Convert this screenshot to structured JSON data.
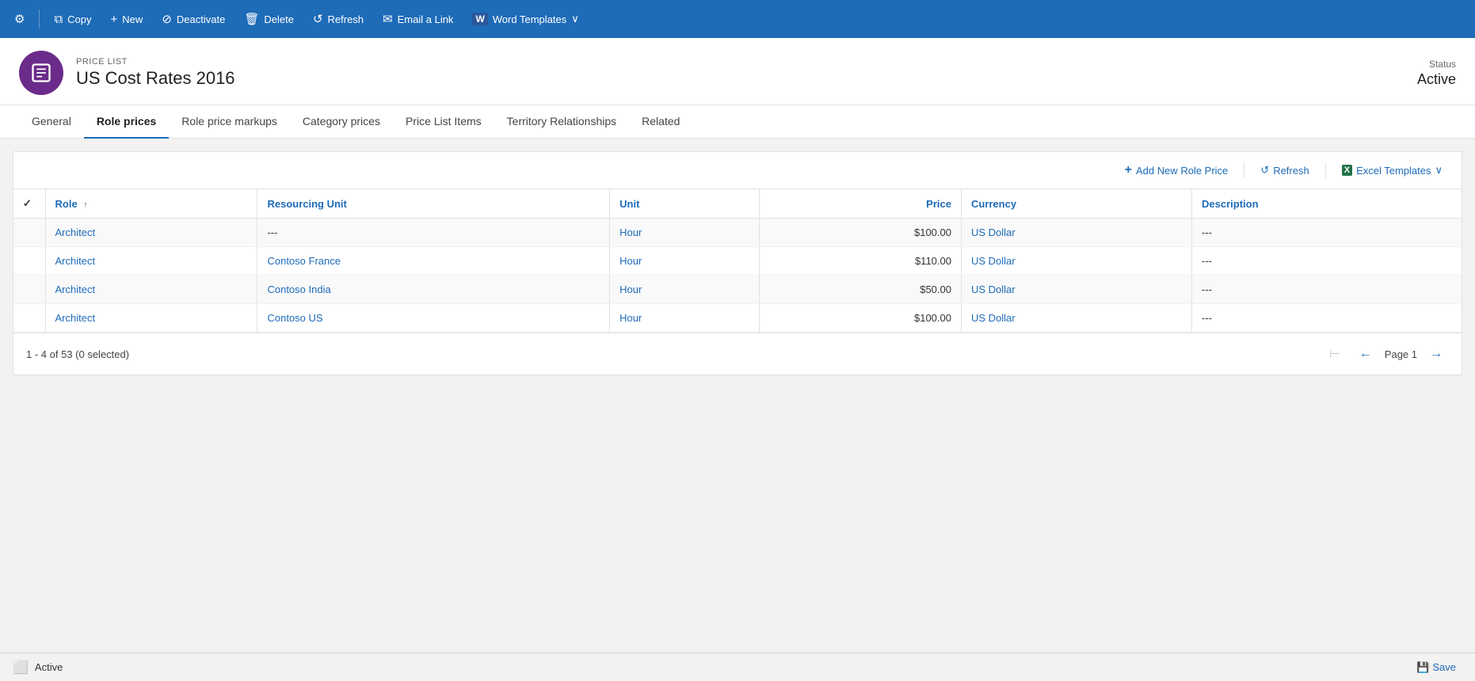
{
  "toolbar": {
    "buttons": [
      {
        "id": "settings",
        "label": "",
        "icon": "⚙"
      },
      {
        "id": "copy",
        "label": "Copy",
        "icon": "⧉"
      },
      {
        "id": "new",
        "label": "New",
        "icon": "+"
      },
      {
        "id": "deactivate",
        "label": "Deactivate",
        "icon": "⊘"
      },
      {
        "id": "delete",
        "label": "Delete",
        "icon": "🗑"
      },
      {
        "id": "refresh",
        "label": "Refresh",
        "icon": "↺"
      },
      {
        "id": "email",
        "label": "Email a Link",
        "icon": "✉"
      },
      {
        "id": "word",
        "label": "Word Templates",
        "icon": "W",
        "hasDropdown": true
      }
    ]
  },
  "record": {
    "type": "PRICE LIST",
    "name": "US Cost Rates 2016",
    "status_label": "Status",
    "status_value": "Active"
  },
  "tabs": [
    {
      "id": "general",
      "label": "General",
      "active": false
    },
    {
      "id": "role-prices",
      "label": "Role prices",
      "active": true
    },
    {
      "id": "role-price-markups",
      "label": "Role price markups",
      "active": false
    },
    {
      "id": "category-prices",
      "label": "Category prices",
      "active": false
    },
    {
      "id": "price-list-items",
      "label": "Price List Items",
      "active": false
    },
    {
      "id": "territory-relationships",
      "label": "Territory Relationships",
      "active": false
    },
    {
      "id": "related",
      "label": "Related",
      "active": false
    }
  ],
  "grid": {
    "add_button_label": "Add New Role Price",
    "refresh_button_label": "Refresh",
    "excel_button_label": "Excel Templates",
    "columns": [
      {
        "id": "check",
        "label": "",
        "type": "check"
      },
      {
        "id": "role",
        "label": "Role",
        "sortable": true
      },
      {
        "id": "resourcing_unit",
        "label": "Resourcing Unit"
      },
      {
        "id": "unit",
        "label": "Unit"
      },
      {
        "id": "price",
        "label": "Price",
        "align": "right"
      },
      {
        "id": "currency",
        "label": "Currency"
      },
      {
        "id": "description",
        "label": "Description"
      }
    ],
    "rows": [
      {
        "role": "Architect",
        "resourcing_unit": "---",
        "unit": "Hour",
        "price": "$100.00",
        "currency": "US Dollar",
        "description": "---"
      },
      {
        "role": "Architect",
        "resourcing_unit": "Contoso France",
        "unit": "Hour",
        "price": "$110.00",
        "currency": "US Dollar",
        "description": "---"
      },
      {
        "role": "Architect",
        "resourcing_unit": "Contoso India",
        "unit": "Hour",
        "price": "$50.00",
        "currency": "US Dollar",
        "description": "---"
      },
      {
        "role": "Architect",
        "resourcing_unit": "Contoso US",
        "unit": "Hour",
        "price": "$100.00",
        "currency": "US Dollar",
        "description": "---"
      }
    ],
    "pagination": {
      "summary": "1 - 4 of 53 (0 selected)",
      "page_label": "Page 1"
    }
  },
  "status_bar": {
    "status": "Active",
    "save_label": "Save"
  }
}
